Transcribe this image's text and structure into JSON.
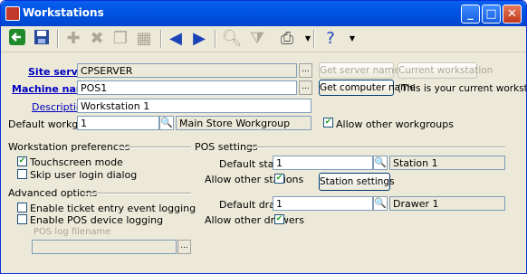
{
  "window": {
    "title": "Workstations"
  },
  "titlebar_buttons": {
    "minimize": "_",
    "maximize": "□",
    "close": "✕"
  },
  "fields": {
    "site_server": {
      "label": "Site server",
      "value": "CPSERVER"
    },
    "machine_name": {
      "label": "Machine name",
      "value": "POS1"
    },
    "description": {
      "label": "Description",
      "value": "Workstation 1"
    },
    "default_workgroup": {
      "label": "Default workgroup",
      "value": "1",
      "lookup": "Main Store Workgroup"
    }
  },
  "buttons": {
    "get_server_name": "Get server name",
    "current_workstation": "Current workstation",
    "get_computer_name": "Get computer name",
    "current_note": "(This is your current workstation)",
    "station_settings": "Station settings",
    "pick": "..."
  },
  "allow_other_workgroups": {
    "label": "Allow other workgroups",
    "checked": true
  },
  "workstation_prefs": {
    "title": "Workstation preferences",
    "touchscreen": {
      "label": "Touchscreen mode",
      "checked": true
    },
    "skip_login": {
      "label": "Skip user login dialog",
      "checked": false
    }
  },
  "advanced": {
    "title": "Advanced options",
    "ticket_logging": {
      "label": "Enable ticket entry event logging",
      "checked": false
    },
    "pos_logging": {
      "label": "Enable POS device logging",
      "checked": false
    },
    "log_filename_label": "POS log filename",
    "log_filename_value": ""
  },
  "pos_settings": {
    "title": "POS settings",
    "default_station": {
      "label": "Default station",
      "value": "1",
      "lookup": "Station 1"
    },
    "allow_other_stations": {
      "label": "Allow other stations",
      "checked": true
    },
    "default_drawer": {
      "label": "Default drawer",
      "value": "1",
      "lookup": "Drawer 1"
    },
    "allow_other_drawers": {
      "label": "Allow other drawers",
      "checked": true
    }
  },
  "check_mark": "✔",
  "icons": {
    "magnifier": "🔍"
  }
}
